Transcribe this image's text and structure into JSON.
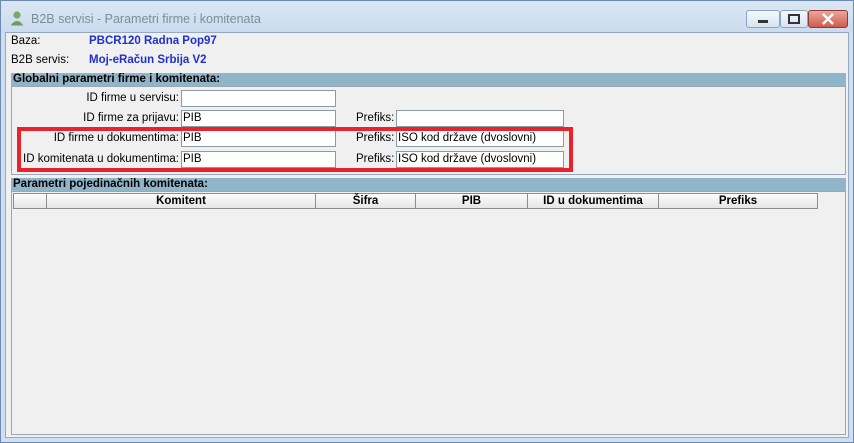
{
  "window": {
    "title": "B2B servisi - Parametri firme i komitenata",
    "icon": "user-icon"
  },
  "header": {
    "baza_label": "Baza:",
    "baza_value": "PBCR120 Radna Pop97",
    "servis_label": "B2B servis:",
    "servis_value": "Moj-eRačun Srbija V2"
  },
  "global": {
    "title": "Globalni parametri firme i komitenata:",
    "id_firme_servis_label": "ID firme u servisu:",
    "id_firme_servis_value": "",
    "id_firme_prijava_label": "ID firme za prijavu:",
    "id_firme_prijava_value": "PIB",
    "prefiks_prijava_label": "Prefiks:",
    "prefiks_prijava_value": "",
    "id_firme_dok_label": "ID firme u dokumentima:",
    "id_firme_dok_value": "PIB",
    "prefiks_firme_dok_label": "Prefiks:",
    "prefiks_firme_dok_value": "ISO kod države (dvoslovni)",
    "id_kom_dok_label": "ID komitenata u dokumentima:",
    "id_kom_dok_value": "PIB",
    "prefiks_kom_dok_label": "Prefiks:",
    "prefiks_kom_dok_value": "ISO kod države (dvoslovni)"
  },
  "komitenti": {
    "title": "Parametri pojedinačnih komitenata:",
    "columns": [
      "",
      "Komitent",
      "Šifra",
      "PIB",
      "ID u dokumentima",
      "Prefiks"
    ]
  },
  "colors": {
    "highlight": "#e8232e",
    "value_blue": "#1f2fd0",
    "section_header": "#90b4c8"
  }
}
